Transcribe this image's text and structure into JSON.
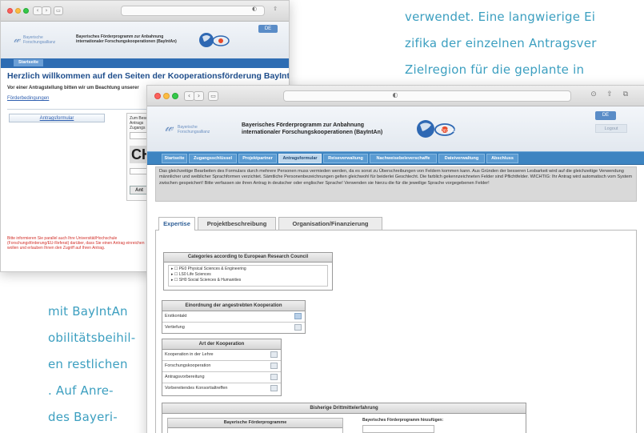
{
  "page_text": {
    "right_lines": [
      "verwendet. Eine langwierige Ei",
      "zifika der einzelnen Antragsver",
      "Zielregion für die geplante in"
    ],
    "left_lines": [
      "mit BayIntAn",
      "obilitätsbeihil-",
      "en restlichen",
      ". Auf Anre-",
      "des Bayeri-"
    ]
  },
  "back_window": {
    "logo_text": "Bayerische Forschungsallianz",
    "header_line1": "Bayerisches Förderprogramm zur Anbahnung",
    "header_line2": "internationaler Forschungskooperationen (BayIntAn)",
    "menu_item": "Startseite",
    "heading": "Herzlich willkommen auf den Seiten der Kooperationsförderung BayIntAn!",
    "intro": "Vor einer Antragstellung bitten wir um Beachtung unserer",
    "link": "Förderbedingungen",
    "form_button": "Antragsformular",
    "side_text_1": "Zum Besu",
    "side_text_2": "Antrags",
    "side_text_3": "Zugangs",
    "captcha_text": "CH",
    "side_button": "Ant",
    "lang_button": "DE",
    "footer_red": "Bitte informieren Sie parallel auch Ihre Universität/Hochschule (Forschungsförderung/EU-Referat) darüber, dass Sie einen Antrag einreichen wollen und erlauben Ihnen den Zugriff auf Ihren Antrag."
  },
  "front_window": {
    "logo_text": "Bayerische Forschungsallianz",
    "header_line1": "Bayerisches Förderprogramm zur Anbahnung",
    "header_line2": "internationaler Forschungskooperationen (BayIntAn)",
    "lang_button": "DE",
    "logout": "Logout",
    "nav": [
      "Startseite",
      "Zugangsschlüssel",
      "Projektpartner",
      "Antragsformular",
      "Reiseverwaltung",
      "Nachweisebeleverschaffe",
      "Dateiverwaltung",
      "Abschluss"
    ],
    "nav_active_index": 3,
    "notice": "Das gleichzeitige Bearbeiten des Formulars durch mehrere Personen muss vermieden werden, da es sonst zu Überschreibungen von Feldern kommen kann. Aus Gründen der besseren Lesbarkeit wird auf die gleichzeitige Verwendung männlicher und weiblicher Sprachformen verzichtet. Sämtliche Personenbezeichnungen gelten gleichwohl für beiderlei Geschlecht. Die farblich gekennzeichneten Felder sind Pflichtfelder. WICHTIG: Ihr Antrag wird automatisch vom System zwischen gespeichert! Bitte verfassen sie ihren Antrag in deutscher oder englischer Sprache! Verwenden sie hierzu die für die jeweilige Sprache vorgegebenen Felder!",
    "tabs": [
      "Expertise",
      "Projektbeschreibung",
      "Organisation/Finanzierung"
    ],
    "active_tab": "Expertise",
    "erc": {
      "title": "Categories according to European Research Council",
      "items": [
        "▸ ☐ PE0 Physical Sciences & Engineering",
        "▸ ☐ LS0 Life Sciences",
        "▸ ☐ SH0 Social Sciences & Humanities"
      ]
    },
    "einordnung": {
      "title": "Einordnung der angestrebten Kooperation",
      "rows": [
        "Erstkontakt",
        "Vertiefung"
      ]
    },
    "art": {
      "title": "Art der Kooperation",
      "rows": [
        "Kooperation in der Lehre",
        "Forschungskooperation",
        "Antragsvorbereitung",
        "Vorbereitendes Konsortialtreffen"
      ]
    },
    "drittmittel": {
      "title": "Bisherige Drittmittelerfahrung",
      "left_header": "Bayerische Förderprogramme",
      "right_label": "Bayerisches Förderprogramm hinzufügen:"
    }
  },
  "colors": {
    "accent_text": "#3c9fc0",
    "nav_blue": "#3d84c1",
    "heading_blue": "#1f4e8c",
    "alert_red": "#d2302a"
  }
}
